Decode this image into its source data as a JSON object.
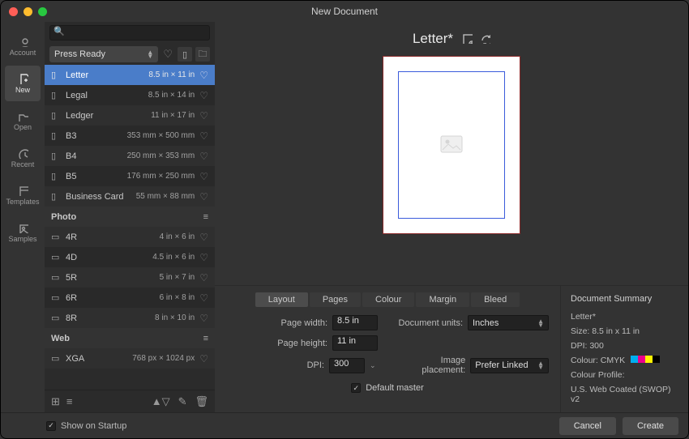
{
  "window": {
    "title": "New Document"
  },
  "sidebar": {
    "items": [
      {
        "label": "Account"
      },
      {
        "label": "New"
      },
      {
        "label": "Open"
      },
      {
        "label": "Recent"
      },
      {
        "label": "Templates"
      },
      {
        "label": "Samples"
      }
    ]
  },
  "presets": {
    "category_selected": "Press Ready",
    "categories": [
      {
        "label": "Photo"
      },
      {
        "label": "Web"
      }
    ],
    "items_press": [
      {
        "name": "Letter",
        "dims": "8.5 in × 11 in"
      },
      {
        "name": "Legal",
        "dims": "8.5 in × 14 in"
      },
      {
        "name": "Ledger",
        "dims": "11 in × 17 in"
      },
      {
        "name": "B3",
        "dims": "353 mm × 500 mm"
      },
      {
        "name": "B4",
        "dims": "250 mm × 353 mm"
      },
      {
        "name": "B5",
        "dims": "176 mm × 250 mm"
      },
      {
        "name": "Business Card",
        "dims": "55 mm × 88 mm"
      }
    ],
    "items_photo": [
      {
        "name": "4R",
        "dims": "4 in × 6 in"
      },
      {
        "name": "4D",
        "dims": "4.5 in × 6 in"
      },
      {
        "name": "5R",
        "dims": "5 in × 7 in"
      },
      {
        "name": "6R",
        "dims": "6 in × 8 in"
      },
      {
        "name": "8R",
        "dims": "8 in × 10 in"
      }
    ],
    "items_web": [
      {
        "name": "XGA",
        "dims": "768 px × 1024 px"
      }
    ]
  },
  "preview": {
    "title": "Letter*"
  },
  "tabs": [
    "Layout",
    "Pages",
    "Colour",
    "Margin",
    "Bleed"
  ],
  "form": {
    "page_width_label": "Page width:",
    "page_width": "8.5 in",
    "page_height_label": "Page height:",
    "page_height": "11 in",
    "dpi_label": "DPI:",
    "dpi": "300",
    "doc_units_label": "Document units:",
    "doc_units": "Inches",
    "image_placement_label": "Image placement:",
    "image_placement": "Prefer Linked",
    "default_master_label": "Default master"
  },
  "summary": {
    "heading": "Document Summary",
    "name": "Letter*",
    "size": "Size: 8.5 in x 11 in",
    "dpi": "DPI:  300",
    "colour_label": "Colour: CMYK",
    "swatches": [
      "#00aeef",
      "#ec008c",
      "#fff200",
      "#000000"
    ],
    "profile_label": "Colour Profile:",
    "profile": "U.S. Web Coated (SWOP) v2"
  },
  "footer": {
    "show_on_startup": "Show on Startup",
    "cancel": "Cancel",
    "create": "Create"
  }
}
